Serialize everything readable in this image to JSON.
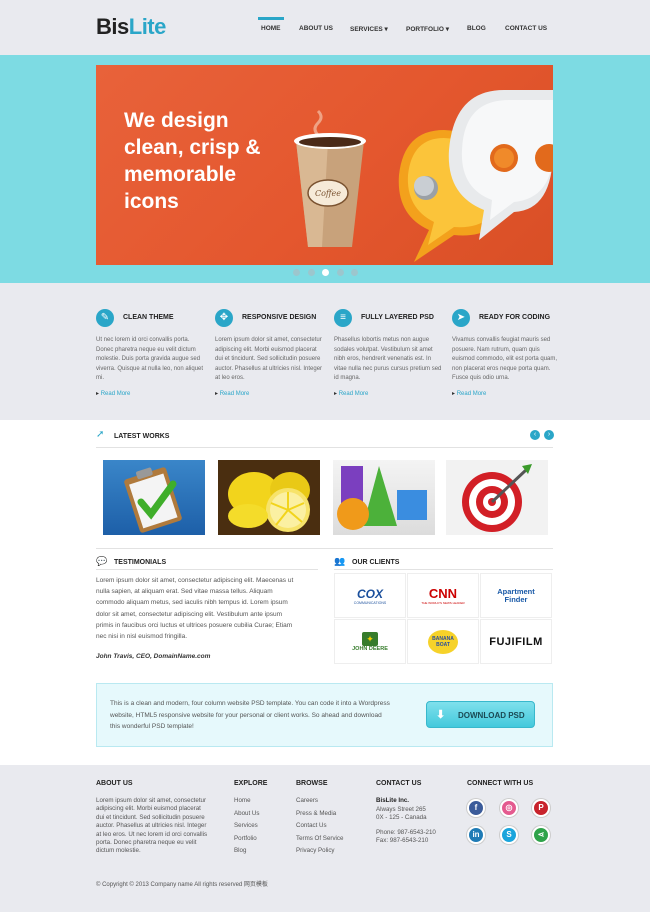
{
  "header": {
    "logo_bold": "Bis",
    "logo_light": "Lite",
    "nav": [
      "HOME",
      "ABOUT US",
      "SERVICES ▾",
      "PORTFOLIO ▾",
      "BLOG",
      "CONTACT US"
    ]
  },
  "hero": {
    "headline": "We design clean, crisp & memorable icons",
    "cup_label": "Coffee",
    "slide_count": 5,
    "active_slide": 3
  },
  "features": [
    {
      "title": "CLEAN THEME",
      "icon": "pencil-icon",
      "body": "Ut nec lorem id orci convallis porta. Donec pharetra neque eu velit dictum molestie. Duis porta gravida augue sed viverra. Quisque at nulla leo, non aliquet mi.",
      "more": "Read More"
    },
    {
      "title": "RESPONSIVE DESIGN",
      "icon": "arrows-icon",
      "body": "Lorem ipsum dolor sit amet, consectetur adipiscing elit. Morbi euismod placerat dui et tincidunt. Sed sollicitudin posuere auctor. Phasellus at ultricies nisl. Integer at leo eros.",
      "more": "Read More"
    },
    {
      "title": "FULLY LAYERED PSD",
      "icon": "layers-icon",
      "body": "Phasellus lobortis metus non augue sodales volutpat. Vestibulum sit amet nibh eros, hendrerit venenatis est. In vitae nulla nec purus cursus pretium sed id magna.",
      "more": "Read More"
    },
    {
      "title": "READY FOR CODING",
      "icon": "cursor-icon",
      "body": "Vivamus convallis feugiat mauris sed posuere. Nam rutrum, quam quis euismod commodo, elit est porta quam, non placerat eros neque porta quam. Fusce quis odio urna.",
      "more": "Read More"
    }
  ],
  "works": {
    "title": "LATEST WORKS",
    "prev": "‹",
    "next": "›",
    "items": [
      "clipboard-check-icon",
      "lemons-image",
      "shapes-image",
      "target-image"
    ]
  },
  "testimonials": {
    "title": "TESTIMONIALS",
    "text": "Lorem ipsum dolor sit amet, consectetur adipiscing elit. Maecenas ut nulla sapien, at aliquam erat. Sed vitae massa tellus. Aliquam commodo aliquam metus, sed iaculis nibh tempus id. Lorem ipsum dolor sit amet, consectetur adipiscing elit. Vestibulum ante ipsum primis in faucibus orci luctus et ultrices posuere cubilia Curae; Etiam nec nisi in nisl euismod fringilla.",
    "author": "John Travis, CEO, DomainName.com"
  },
  "clients": {
    "title": "OUR CLIENTS",
    "logos": [
      {
        "name": "COX",
        "sub": "COMMUNICATIONS",
        "color": "#1a4f9c"
      },
      {
        "name": "CNN",
        "sub": "THE WORLD'S NEWS LEADER",
        "color": "#cc0000"
      },
      {
        "name": "Apartment Finder",
        "sub": "",
        "color": "#1a5aa8"
      },
      {
        "name": "JOHN DEERE",
        "sub": "",
        "color": "#367c2b"
      },
      {
        "name": "BANANA BOAT",
        "sub": "",
        "color": "#2a4d9c"
      },
      {
        "name": "FUJIFILM",
        "sub": "",
        "color": "#111111"
      }
    ]
  },
  "cta": {
    "text": "This is a clean and modern, four column website PSD template. You can code it into a Wordpress website, HTML5 responsive website for your personal or client works. So ahead and download this wonderful PSD template!",
    "button": "DOWNLOAD PSD"
  },
  "footer": {
    "about_title": "ABOUT US",
    "about_text": "Lorem ipsum dolor sit amet, consectetur adipiscing elit. Morbi euismod placerat dui et tincidunt. Sed sollicitudin posuere auctor. Phasellus at ultricies nisl. Integer at leo eros. Ut nec lorem id orci convallis porta. Donec pharetra neque eu velit dictum molestie.",
    "explore_title": "EXPLORE",
    "explore": [
      "Home",
      "About Us",
      "Services",
      "Portfolio",
      "Blog"
    ],
    "browse_title": "BROWSE",
    "browse": [
      "Careers",
      "Press & Media",
      "Contact Us",
      "Terms Of Service",
      "Privacy Policy"
    ],
    "contact_title": "CONTACT US",
    "contact_name": "BisLite Inc.",
    "contact_lines": [
      "Always Street 265",
      "0X - 125 - Canada",
      "",
      "Phone: 987-6543-210",
      "Fax: 987-6543-210"
    ],
    "connect_title": "CONNECT WITH US",
    "social": [
      {
        "name": "facebook-icon",
        "glyph": "f",
        "color": "#3b5b9a"
      },
      {
        "name": "dribbble-icon",
        "glyph": "◎",
        "color": "#e45a8f"
      },
      {
        "name": "pinterest-icon",
        "glyph": "P",
        "color": "#c8232c"
      },
      {
        "name": "linkedin-icon",
        "glyph": "in",
        "color": "#1f7bb6"
      },
      {
        "name": "skype-icon",
        "glyph": "S",
        "color": "#1aa5dc"
      },
      {
        "name": "share-icon",
        "glyph": "⋖",
        "color": "#2fa34a"
      }
    ],
    "copyright": "© Copyright © 2013 Company name All rights reserved 网页模板"
  }
}
